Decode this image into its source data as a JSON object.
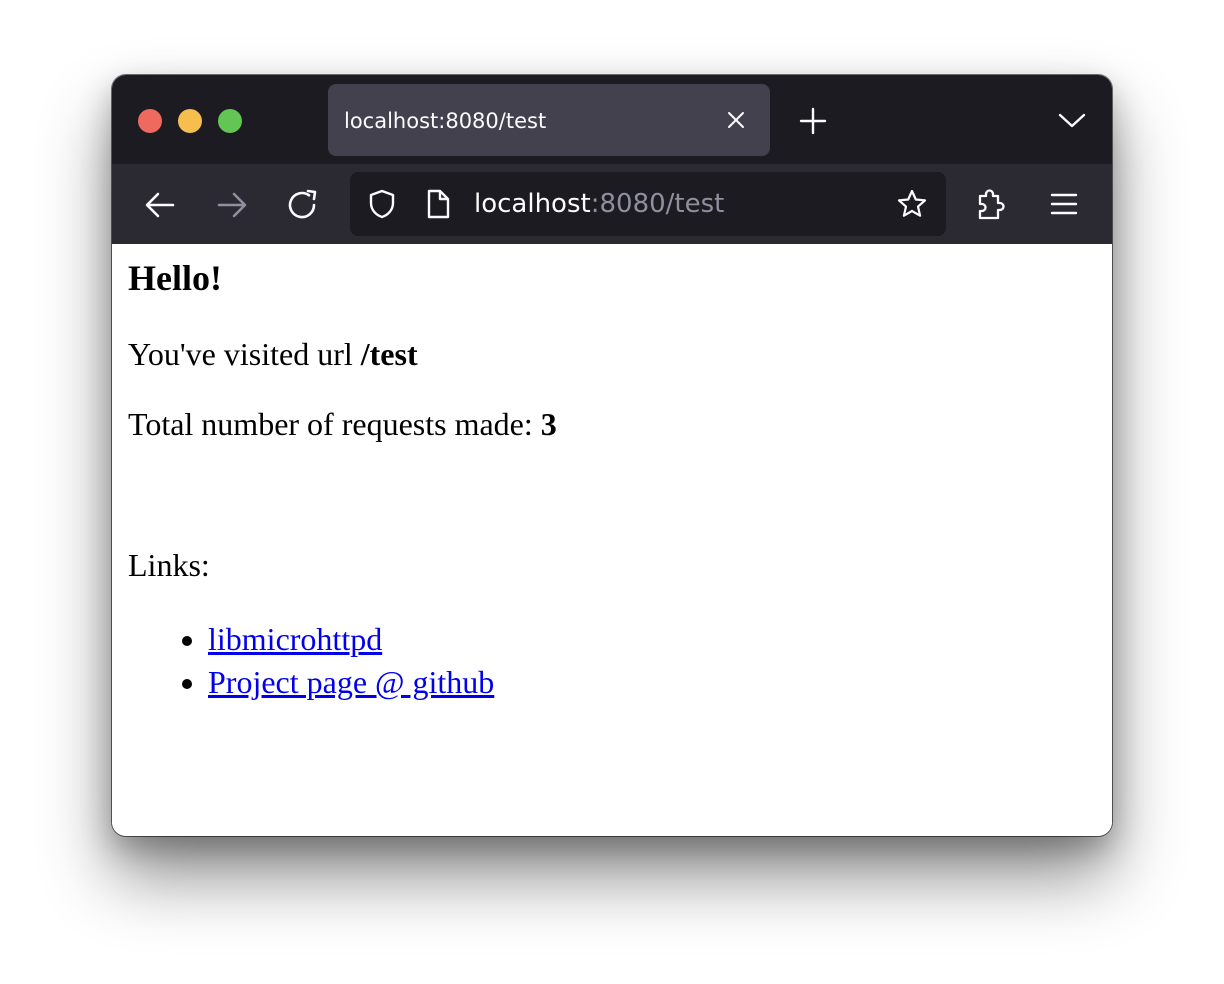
{
  "browser": {
    "tab": {
      "title": "localhost:8080/test"
    },
    "url": {
      "host": "localhost",
      "path": ":8080/test"
    },
    "icons": {
      "traffic_close": "close-window-dot",
      "traffic_minimize": "minimize-window-dot",
      "traffic_maximize": "maximize-window-dot",
      "tab_close": "close-icon",
      "new_tab": "plus-icon",
      "tab_list": "chevron-down-icon",
      "back": "arrow-left-icon",
      "forward": "arrow-right-icon",
      "reload": "reload-icon",
      "tracking_protection": "shield-icon",
      "page_info": "page-icon",
      "bookmark": "star-icon",
      "extensions": "puzzle-icon",
      "menu": "hamburger-menu-icon"
    },
    "colors": {
      "titlebar": "#1c1b22",
      "tab_active": "#42414d",
      "toolbar": "#2b2a33",
      "urlbar": "#1c1b22",
      "traffic_red": "#ee6a5e",
      "traffic_yellow": "#f5be4f",
      "traffic_green": "#62c554",
      "link": "#0000ee"
    }
  },
  "page": {
    "heading": "Hello!",
    "visited_prefix": "You've visited url ",
    "visited_url": "/test",
    "requests_prefix": "Total number of requests made: ",
    "requests_count": "3",
    "links_label": "Links:",
    "links": [
      {
        "label": "libmicrohttpd"
      },
      {
        "label": "Project page @ github"
      }
    ]
  }
}
